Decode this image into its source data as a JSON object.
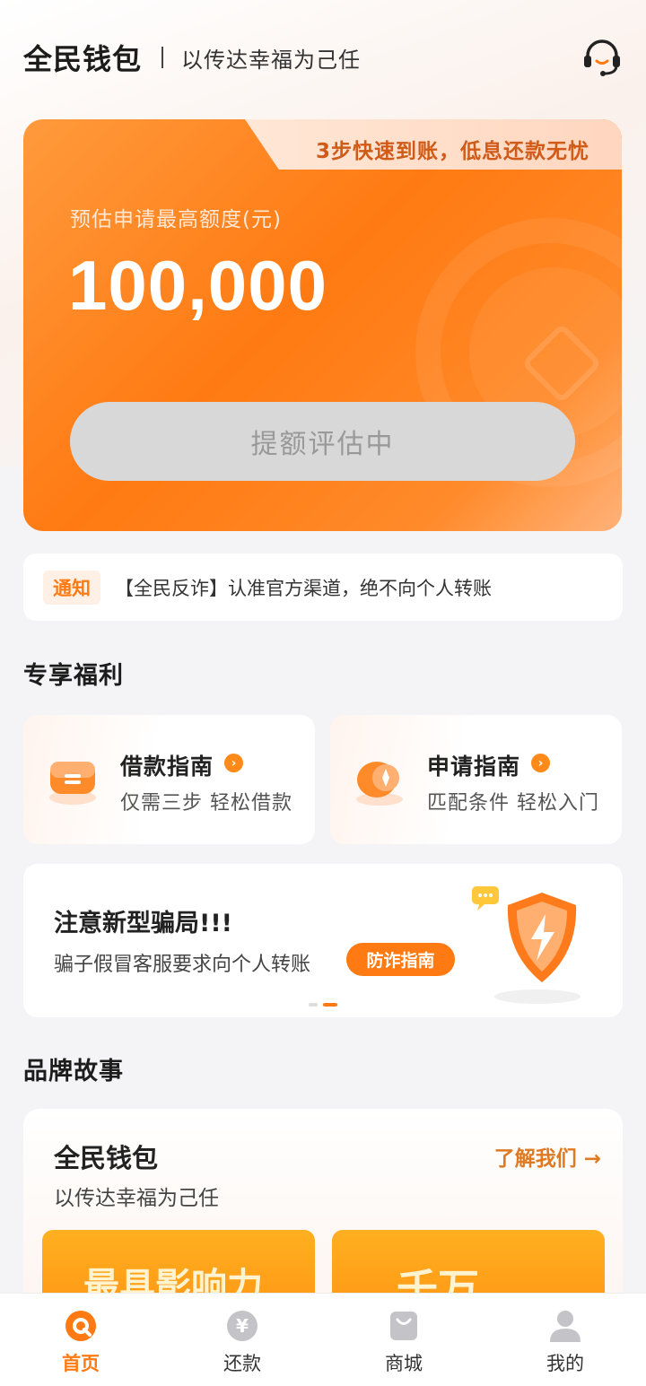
{
  "header": {
    "brand": "全民钱包",
    "slogan": "以传达幸福为己任",
    "service_icon": "customer-service-headset-icon"
  },
  "hero": {
    "tab_text": "3步快速到账，低息还款无忧",
    "label": "预估申请最高额度(元)",
    "amount": "100,000",
    "button_label": "提额评估中"
  },
  "notice": {
    "badge": "通知",
    "text": "【全民反诈】认准官方渠道，绝不向个人转账"
  },
  "welfare": {
    "title": "专享福利",
    "cards": [
      {
        "title": "借款指南",
        "subtitle": "仅需三步 轻松借款",
        "icon": "wallet-icon"
      },
      {
        "title": "申请指南",
        "subtitle": "匹配条件 轻松入门",
        "icon": "compass-icon"
      }
    ]
  },
  "banner": {
    "title": "注意新型骗局!!!",
    "subtitle": "骗子假冒客服要求向个人转账",
    "button": "防诈指南",
    "icon": "shield-lightning-icon",
    "page_count": 2,
    "active_page": 2
  },
  "story": {
    "section_title": "品牌故事",
    "title": "全民钱包",
    "subtitle": "以传达幸福为己任",
    "link": "了解我们 →",
    "images": [
      {
        "text": "最具影响力"
      },
      {
        "text": "千万"
      }
    ]
  },
  "nav": {
    "items": [
      {
        "label": "首页",
        "icon": "home-icon",
        "active": true
      },
      {
        "label": "还款",
        "icon": "repay-yen-icon",
        "active": false
      },
      {
        "label": "商城",
        "icon": "shop-bag-icon",
        "active": false
      },
      {
        "label": "我的",
        "icon": "profile-icon",
        "active": false
      }
    ]
  },
  "colors": {
    "accent": "#ff7a12",
    "background": "#f4f4f6"
  }
}
